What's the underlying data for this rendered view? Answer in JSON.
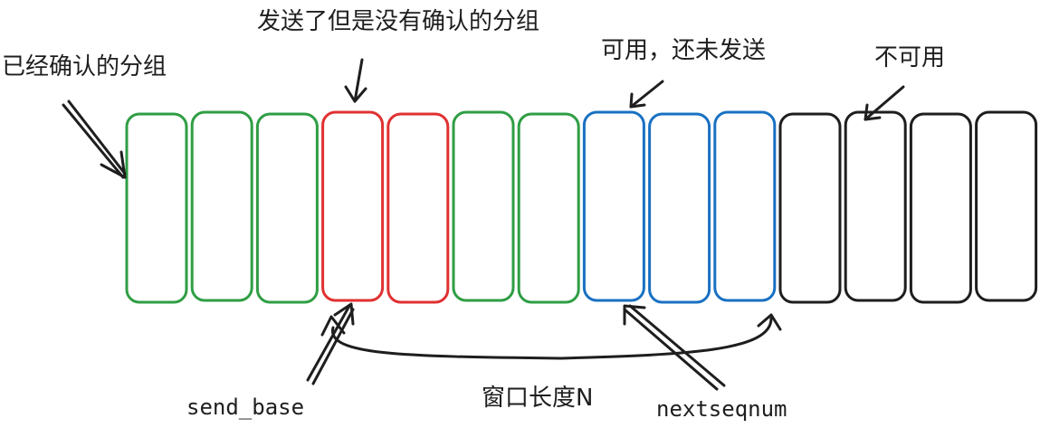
{
  "labels": {
    "acked": "已经确认的分组",
    "sent_unacked": "发送了但是没有确认的分组",
    "usable": "可用，还未发送",
    "unusable": "不可用",
    "send_base": "send_base",
    "window": "窗口长度N",
    "nextseqnum": "nextseqnum"
  },
  "colors": {
    "acked": "#2f9e44",
    "sent_unacked": "#e03131",
    "usable": "#1971c2",
    "unusable": "#1e1e1e"
  },
  "packets": [
    {
      "state": "acked"
    },
    {
      "state": "acked"
    },
    {
      "state": "acked"
    },
    {
      "state": "sent_unacked"
    },
    {
      "state": "sent_unacked"
    },
    {
      "state": "acked"
    },
    {
      "state": "acked"
    },
    {
      "state": "usable"
    },
    {
      "state": "usable"
    },
    {
      "state": "usable"
    },
    {
      "state": "unusable"
    },
    {
      "state": "unusable"
    },
    {
      "state": "unusable"
    },
    {
      "state": "unusable"
    }
  ]
}
